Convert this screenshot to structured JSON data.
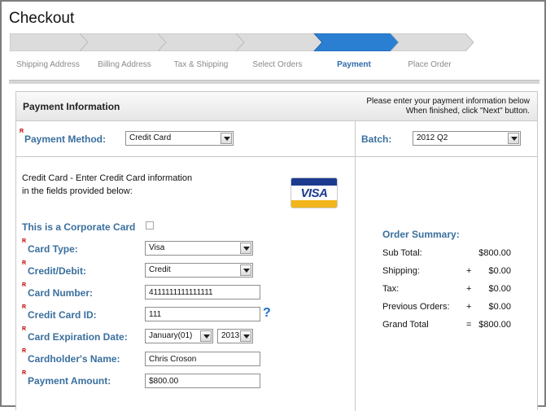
{
  "page": {
    "title": "Checkout"
  },
  "steps": [
    {
      "label": "Shipping Address",
      "active": false
    },
    {
      "label": "Billing Address",
      "active": false
    },
    {
      "label": "Tax & Shipping",
      "active": false
    },
    {
      "label": "Select Orders",
      "active": false
    },
    {
      "label": "Payment",
      "active": true
    },
    {
      "label": "Place Order",
      "active": false
    }
  ],
  "colors": {
    "step_active": "#2a7fd2",
    "step_inactive": "#dcdcdc",
    "label_blue": "#3a6f9e",
    "required_red": "#c00000"
  },
  "panel": {
    "title": "Payment Information",
    "hint_line1": "Please enter your payment information below",
    "hint_line2": "When finished, click \"Next\" button."
  },
  "payment_method": {
    "required_mark": "R",
    "label": "Payment Method:",
    "value": "Credit Card"
  },
  "batch": {
    "label": "Batch:",
    "value": "2012 Q2"
  },
  "card_intro": {
    "line1": "Credit Card - Enter Credit Card information",
    "line2": "in the fields provided below:"
  },
  "card_logo": {
    "text": "VISA"
  },
  "form": {
    "corporate_label": "This is a Corporate Card",
    "corporate_checked": false,
    "card_type": {
      "required_mark": "R",
      "label": "Card Type:",
      "value": "Visa"
    },
    "credit_debit": {
      "required_mark": "R",
      "label": "Credit/Debit:",
      "value": "Credit"
    },
    "card_number": {
      "required_mark": "R",
      "label": "Card Number:",
      "value": "4111111111111111"
    },
    "card_id": {
      "required_mark": "R",
      "label": "Credit Card ID:",
      "value": "111",
      "help_icon": "question-icon",
      "help_glyph": "?"
    },
    "expiration": {
      "required_mark": "R",
      "label": "Card Expiration Date:",
      "month": "January(01)",
      "year": "2013"
    },
    "holder_name": {
      "required_mark": "R",
      "label": "Cardholder's Name:",
      "value": "Chris Croson"
    },
    "payment_amount": {
      "required_mark": "R",
      "label": "Payment Amount:",
      "value": "$800.00"
    }
  },
  "order_summary": {
    "title": "Order Summary:",
    "rows": [
      {
        "label": "Sub Total:",
        "op": "",
        "value": "$800.00"
      },
      {
        "label": "Shipping:",
        "op": "+",
        "value": "$0.00"
      },
      {
        "label": "Tax:",
        "op": "+",
        "value": "$0.00"
      },
      {
        "label": "Previous Orders:",
        "op": "+",
        "value": "$0.00"
      },
      {
        "label": "Grand Total",
        "op": "=",
        "value": "$800.00"
      }
    ]
  }
}
